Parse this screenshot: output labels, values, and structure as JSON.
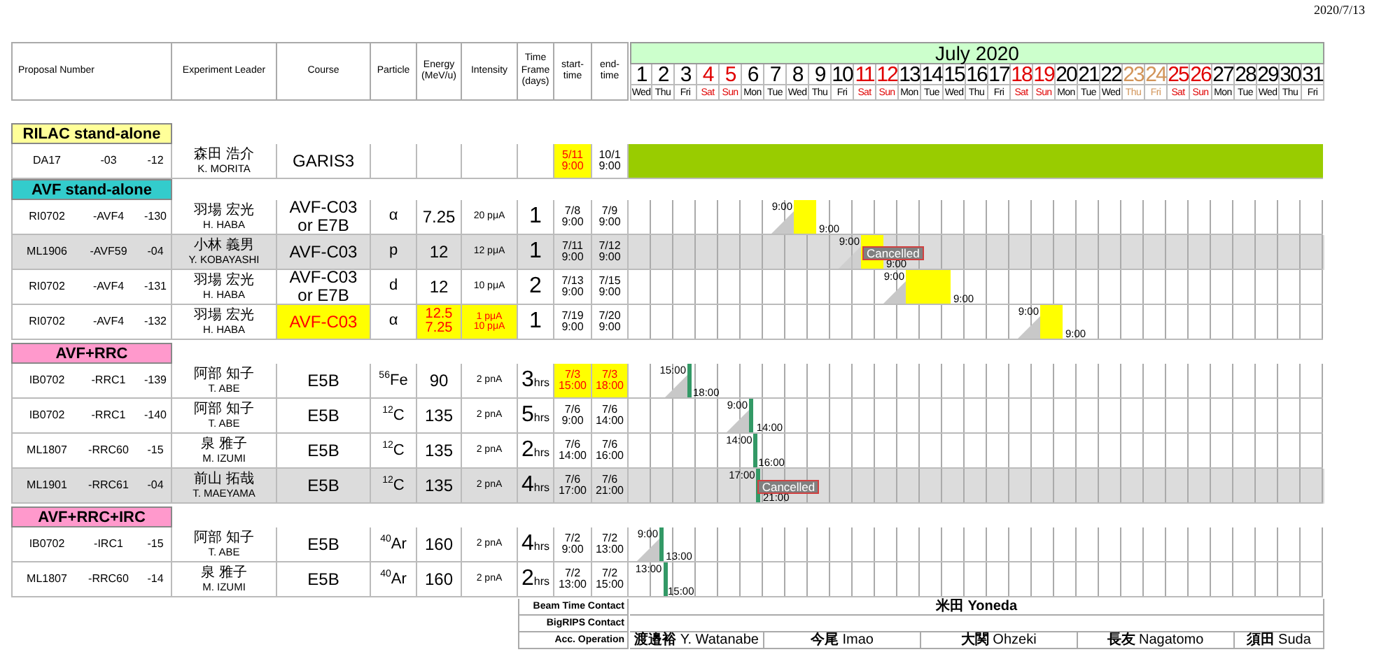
{
  "date": "2020/7/13",
  "header": {
    "proposal": "Proposal Number",
    "leader": "Experiment Leader",
    "course": "Course",
    "particle": "Particle",
    "energy": "Energy (MeV/u)",
    "intensity": "Intensity",
    "timeframe": "Time Frame (days)",
    "start": "start-time",
    "end": "end-time"
  },
  "month": "July 2020",
  "days": [
    {
      "day": "1",
      "weekday": "Wed",
      "kind": "weekday"
    },
    {
      "day": "2",
      "weekday": "Thu",
      "kind": "weekday"
    },
    {
      "day": "3",
      "weekday": "Fri",
      "kind": "weekday"
    },
    {
      "day": "4",
      "weekday": "Sat",
      "kind": "weekend"
    },
    {
      "day": "5",
      "weekday": "Sun",
      "kind": "weekend"
    },
    {
      "day": "6",
      "weekday": "Mon",
      "kind": "weekday"
    },
    {
      "day": "7",
      "weekday": "Tue",
      "kind": "weekday"
    },
    {
      "day": "8",
      "weekday": "Wed",
      "kind": "weekday"
    },
    {
      "day": "9",
      "weekday": "Thu",
      "kind": "weekday"
    },
    {
      "day": "10",
      "weekday": "Fri",
      "kind": "weekday"
    },
    {
      "day": "11",
      "weekday": "Sat",
      "kind": "weekend"
    },
    {
      "day": "12",
      "weekday": "Sun",
      "kind": "weekend"
    },
    {
      "day": "13",
      "weekday": "Mon",
      "kind": "weekday"
    },
    {
      "day": "14",
      "weekday": "Tue",
      "kind": "weekday"
    },
    {
      "day": "15",
      "weekday": "Wed",
      "kind": "weekday"
    },
    {
      "day": "16",
      "weekday": "Thu",
      "kind": "weekday"
    },
    {
      "day": "17",
      "weekday": "Fri",
      "kind": "weekday"
    },
    {
      "day": "18",
      "weekday": "Sat",
      "kind": "weekend"
    },
    {
      "day": "19",
      "weekday": "Sun",
      "kind": "weekend"
    },
    {
      "day": "20",
      "weekday": "Mon",
      "kind": "weekday"
    },
    {
      "day": "21",
      "weekday": "Tue",
      "kind": "weekday"
    },
    {
      "day": "22",
      "weekday": "Wed",
      "kind": "weekday"
    },
    {
      "day": "23",
      "weekday": "Thu",
      "kind": "holiday"
    },
    {
      "day": "24",
      "weekday": "Fri",
      "kind": "holiday"
    },
    {
      "day": "25",
      "weekday": "Sat",
      "kind": "weekend"
    },
    {
      "day": "26",
      "weekday": "Sun",
      "kind": "weekend"
    },
    {
      "day": "27",
      "weekday": "Mon",
      "kind": "weekday"
    },
    {
      "day": "28",
      "weekday": "Tue",
      "kind": "weekday"
    },
    {
      "day": "29",
      "weekday": "Wed",
      "kind": "weekday"
    },
    {
      "day": "30",
      "weekday": "Thu",
      "kind": "weekday"
    },
    {
      "day": "31",
      "weekday": "Fri",
      "kind": "weekday"
    }
  ],
  "sections": [
    {
      "title": "RILAC stand-alone",
      "color": "#ffff99",
      "rows": [
        {
          "code": "DA17",
          "suffix": "-03",
          "number": "-12",
          "leader_ja": "森田 浩介",
          "leader_en": "K. MORITA",
          "course": "GARIS3",
          "start": "5/11\n9:00",
          "end": "10/1\n9:00",
          "course_changed": false,
          "energy_changed": false,
          "intensity_changed": false,
          "start_changed": true,
          "end_changed": false,
          "cancelled": false,
          "setup_ramp": false,
          "color": "#99cc00"
        }
      ]
    },
    {
      "title": "AVF stand-alone",
      "color": "#33cccc",
      "rows": [
        {
          "code": "RI0702",
          "suffix": "-AVF4",
          "number": "-130",
          "leader_ja": "羽場 宏光",
          "leader_en": "H. HABA",
          "course": "AVF-C03\nor E7B",
          "particle": "α",
          "energy": "7.25",
          "intensity": "20 pμA",
          "timeframe": "1",
          "start": "7/8\n9:00",
          "end": "7/9\n9:00",
          "start_label": "9:00",
          "end_label": "9:00",
          "course_changed": false,
          "energy_changed": false,
          "intensity_changed": false,
          "start_changed": false,
          "end_changed": false,
          "cancelled": false,
          "setup_ramp": true,
          "color": "#ffff00"
        },
        {
          "code": "ML1906",
          "suffix": "-AVF59",
          "number": "-04",
          "leader_ja": "小林 義男",
          "leader_en": "Y. KOBAYASHI",
          "course": "AVF-C03",
          "particle": "p",
          "energy": "12",
          "intensity": "12 pμA",
          "timeframe": "1",
          "start": "7/11\n9:00",
          "end": "7/12\n9:00",
          "start_label": "9:00",
          "end_label": "9:00",
          "course_changed": false,
          "energy_changed": false,
          "intensity_changed": false,
          "start_changed": false,
          "end_changed": false,
          "cancelled": true,
          "cancel_text": "Cancelled",
          "setup_ramp": true,
          "color": "#ffff00"
        },
        {
          "code": "RI0702",
          "suffix": "-AVF4",
          "number": "-131",
          "leader_ja": "羽場 宏光",
          "leader_en": "H. HABA",
          "course": "AVF-C03\nor E7B",
          "particle": "d",
          "energy": "12",
          "intensity": "10 pμA",
          "timeframe": "2",
          "start": "7/13\n9:00",
          "end": "7/15\n9:00",
          "start_label": "9:00",
          "end_label": "9:00",
          "course_changed": false,
          "energy_changed": false,
          "intensity_changed": false,
          "start_changed": false,
          "end_changed": false,
          "cancelled": false,
          "setup_ramp": true,
          "color": "#ffff00"
        },
        {
          "code": "RI0702",
          "suffix": "-AVF4",
          "number": "-132",
          "leader_ja": "羽場 宏光",
          "leader_en": "H. HABA",
          "course": "AVF-C03",
          "particle": "α",
          "energy": "12.5\n7.25",
          "intensity": "1 pμA\n10 pμA",
          "timeframe": "1",
          "start": "7/19\n9:00",
          "end": "7/20\n9:00",
          "start_label": "9:00",
          "end_label": "9:00",
          "course_changed": true,
          "energy_changed": true,
          "intensity_changed": true,
          "start_changed": false,
          "end_changed": false,
          "cancelled": false,
          "setup_ramp": true,
          "color": "#ffff00"
        }
      ]
    },
    {
      "title": "AVF+RRC",
      "color": "#ff99cc",
      "rows": [
        {
          "code": "IB0702",
          "suffix": "-RRC1",
          "number": "-139",
          "leader_ja": "阿部 知子",
          "leader_en": "T. ABE",
          "course": "E5B",
          "particle": "$^{56}$Fe",
          "energy": "90",
          "intensity": "2 pnA",
          "timeframe": "3$_{hrs}$",
          "start": "7/3\n15:00",
          "end": "7/3\n18:00",
          "start_label": "15:00",
          "end_label": "18:00",
          "course_changed": false,
          "energy_changed": false,
          "intensity_changed": false,
          "start_changed": true,
          "end_changed": true,
          "cancelled": false,
          "setup_ramp": true,
          "color": "#339966"
        },
        {
          "code": "IB0702",
          "suffix": "-RRC1",
          "number": "-140",
          "leader_ja": "阿部 知子",
          "leader_en": "T. ABE",
          "course": "E5B",
          "particle": "$^{12}$C",
          "energy": "135",
          "intensity": "2 pnA",
          "timeframe": "5$_{hrs}$",
          "start": "7/6\n9:00",
          "end": "7/6\n14:00",
          "start_label": "9:00",
          "end_label": "14:00",
          "course_changed": false,
          "energy_changed": false,
          "intensity_changed": false,
          "start_changed": false,
          "end_changed": false,
          "cancelled": false,
          "setup_ramp": true,
          "color": "#339966"
        },
        {
          "code": "ML1807",
          "suffix": "-RRC60",
          "number": "-15",
          "leader_ja": "泉 雅子",
          "leader_en": "M. IZUMI",
          "course": "E5B",
          "particle": "$^{12}$C",
          "energy": "135",
          "intensity": "2 pnA",
          "timeframe": "2$_{hrs}$",
          "start": "7/6\n14:00",
          "end": "7/6\n16:00",
          "start_label": "14:00",
          "end_label": "16:00",
          "course_changed": false,
          "energy_changed": false,
          "intensity_changed": false,
          "start_changed": false,
          "end_changed": false,
          "cancelled": false,
          "setup_ramp": false,
          "color": "#339966"
        },
        {
          "code": "ML1901",
          "suffix": "-RRC61",
          "number": "-04",
          "leader_ja": "前山 拓哉",
          "leader_en": "T. MAEYAMA",
          "course": "E5B",
          "particle": "$^{12}$C",
          "energy": "135",
          "intensity": "2 pnA",
          "timeframe": "4$_{hrs}$",
          "start": "7/6\n17:00",
          "end": "7/6\n21:00",
          "start_label": "17:00",
          "end_label": "21:00",
          "course_changed": false,
          "energy_changed": false,
          "intensity_changed": false,
          "start_changed": false,
          "end_changed": false,
          "cancelled": true,
          "cancel_text": "Cancelled",
          "setup_ramp": false,
          "color": "#339966"
        }
      ]
    },
    {
      "title": "AVF+RRC+IRC",
      "color": "#ff99cc",
      "rows": [
        {
          "code": "IB0702",
          "suffix": "-IRC1",
          "number": "-15",
          "leader_ja": "阿部 知子",
          "leader_en": "T. ABE",
          "course": "E5B",
          "particle": "$^{40}$Ar",
          "energy": "160",
          "intensity": "2 pnA",
          "timeframe": "4$_{hrs}$",
          "start": "7/2\n9:00",
          "end": "7/2\n13:00",
          "start_label": "9:00",
          "end_label": "13:00",
          "course_changed": false,
          "energy_changed": false,
          "intensity_changed": false,
          "start_changed": false,
          "end_changed": false,
          "cancelled": false,
          "setup_ramp": true,
          "color": "#339966"
        },
        {
          "code": "ML1807",
          "suffix": "-RRC60",
          "number": "-14",
          "leader_ja": "泉 雅子",
          "leader_en": "M. IZUMI",
          "course": "E5B",
          "particle": "$^{40}$Ar",
          "energy": "160",
          "intensity": "2 pnA",
          "timeframe": "2$_{hrs}$",
          "start": "7/2\n13:00",
          "end": "7/2\n15:00",
          "start_label": "13:00",
          "end_label": "15:00",
          "course_changed": false,
          "energy_changed": false,
          "intensity_changed": false,
          "start_changed": false,
          "end_changed": false,
          "cancelled": false,
          "setup_ramp": false,
          "color": "#339966"
        }
      ]
    }
  ],
  "contacts": [
    {
      "label": "Beam Time Contact",
      "values": [
        "**米田** **Yoneda**"
      ]
    },
    {
      "label": "BigRIPS Contact"
    },
    {
      "label": "Acc. Operation",
      "values": [
        "**渡邉裕** Y. Watanabe",
        "**今尾** Imao",
        "**大関** Ohzeki",
        "**長友** Nagatomo",
        "**須田** Suda"
      ]
    }
  ]
}
